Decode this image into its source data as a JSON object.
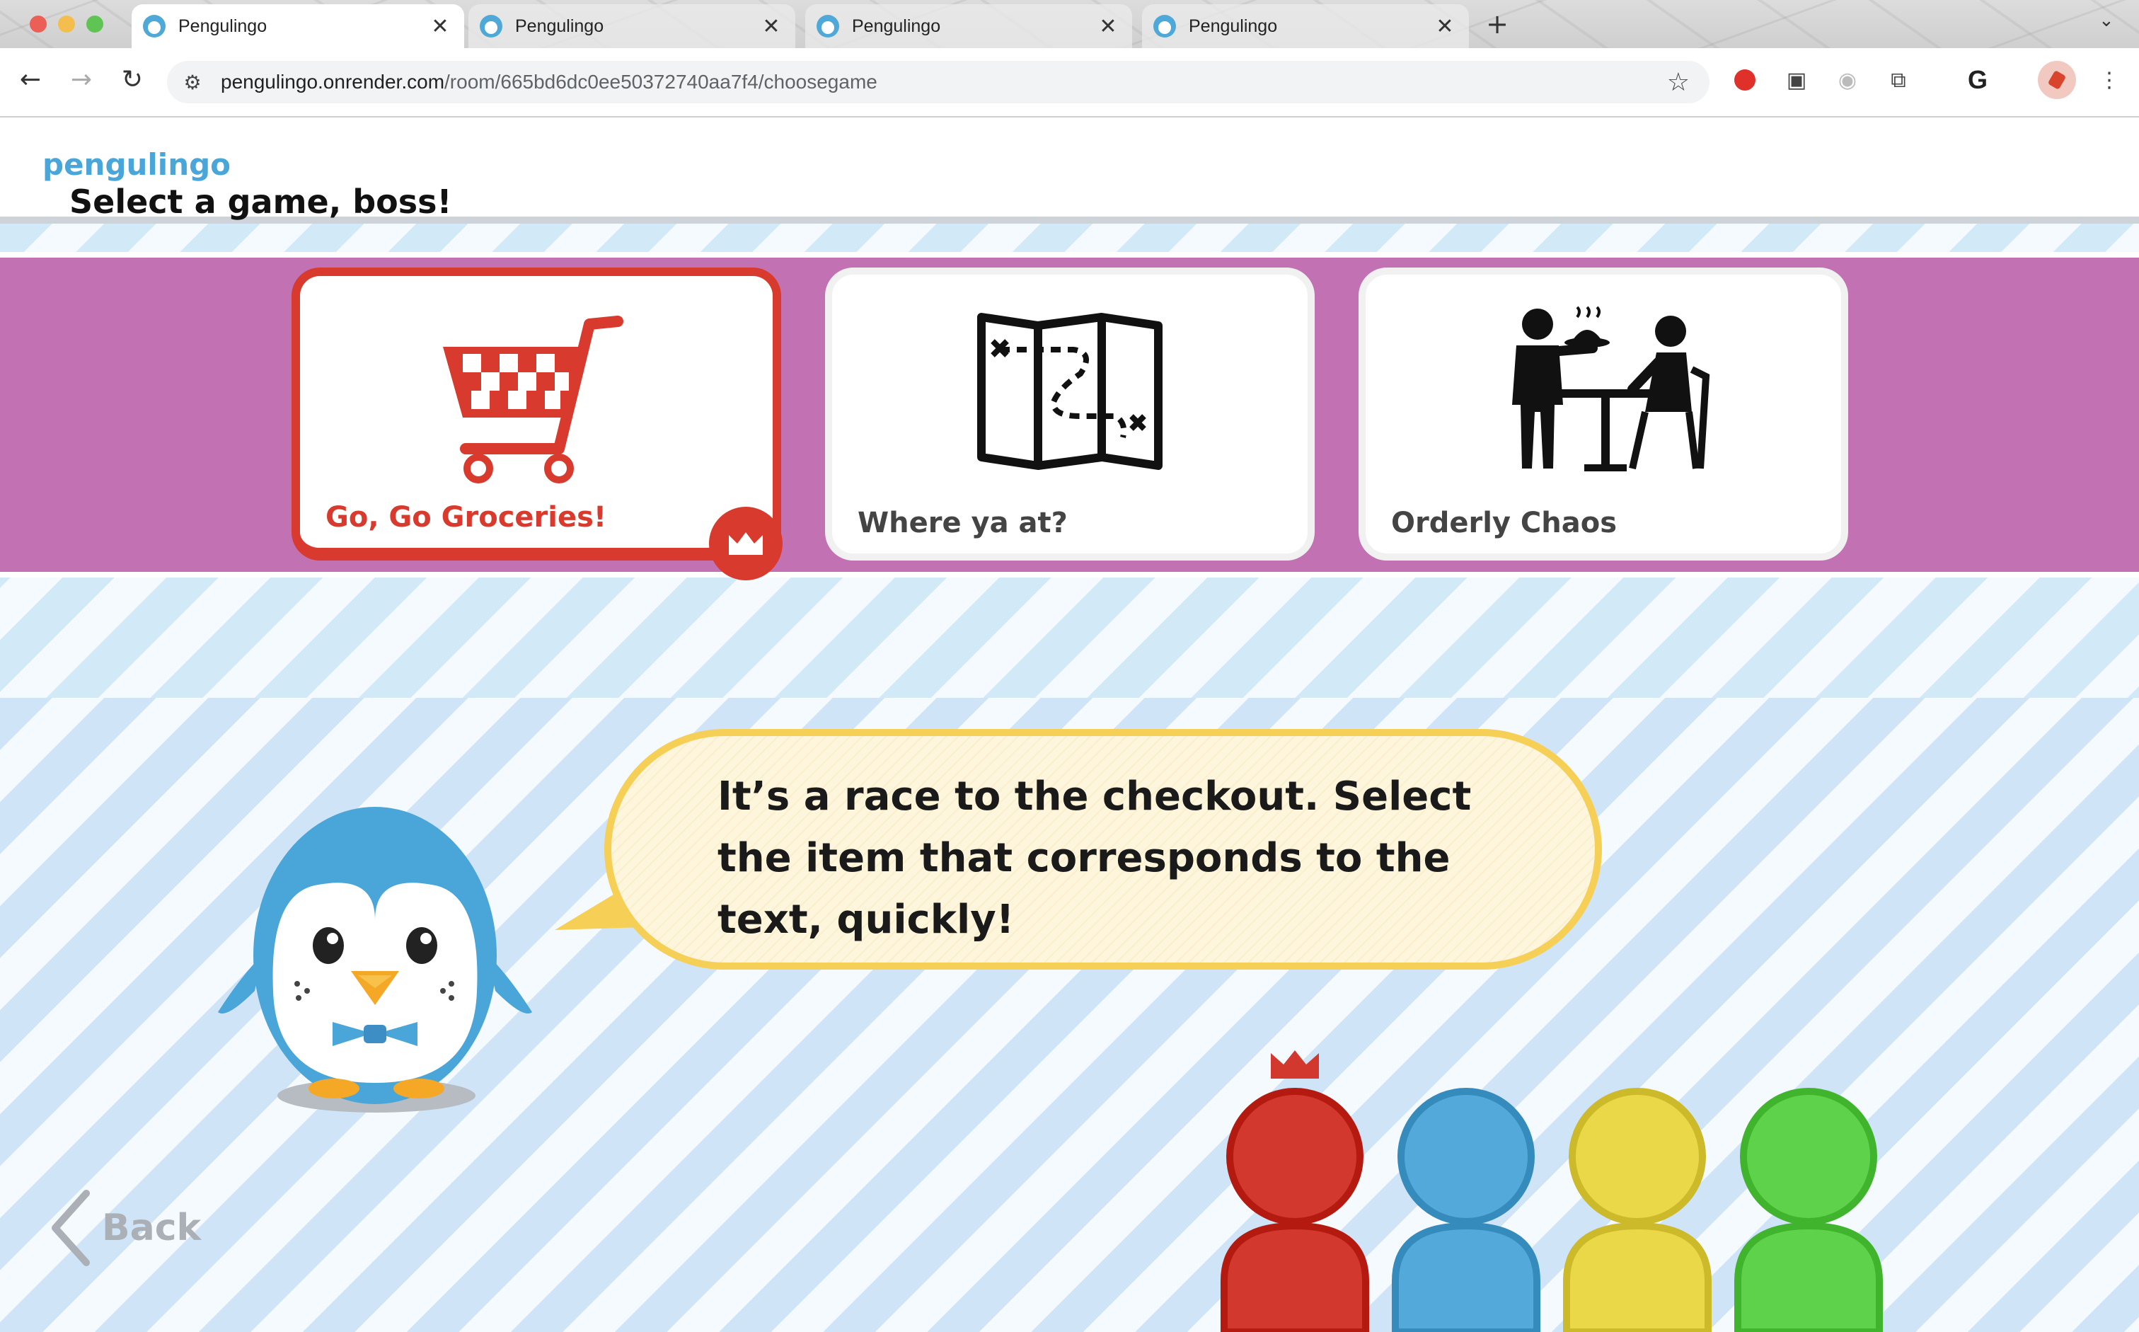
{
  "browser": {
    "tabs": [
      {
        "title": "Pengulingo",
        "active": true
      },
      {
        "title": "Pengulingo",
        "active": false
      },
      {
        "title": "Pengulingo",
        "active": false
      },
      {
        "title": "Pengulingo",
        "active": false
      }
    ],
    "close_glyph": "✕",
    "new_tab_glyph": "+",
    "tab_menu_glyph": "⌄",
    "url_domain": "pengulingo.onrender.com",
    "url_path": "/room/665bd6dc0ee50372740aa7f4/choosegame"
  },
  "app": {
    "logo": "pengulingo",
    "heading": "Select a game, boss!",
    "games": [
      {
        "label": "Go, Go Groceries!",
        "icon": "shopping-cart-icon",
        "selected": true
      },
      {
        "label": "Where ya at?",
        "icon": "treasure-map-icon",
        "selected": false
      },
      {
        "label": "Orderly Chaos",
        "icon": "waiter-restaurant-icon",
        "selected": false
      }
    ],
    "description": "It’s a race to the checkout. Select the item that corresponds to the text, quickly!",
    "back_label": "Back",
    "players": [
      {
        "color": "#d3382e",
        "host": true
      },
      {
        "color": "#52a9da",
        "host": false
      },
      {
        "color": "#ead849",
        "host": false
      },
      {
        "color": "#5fd24c",
        "host": false
      }
    ]
  },
  "colors": {
    "accent_red": "#d83a2e",
    "band_purple": "#c272b3",
    "logo_blue": "#4aa6d8",
    "bubble_yellow": "#f6cf57"
  }
}
